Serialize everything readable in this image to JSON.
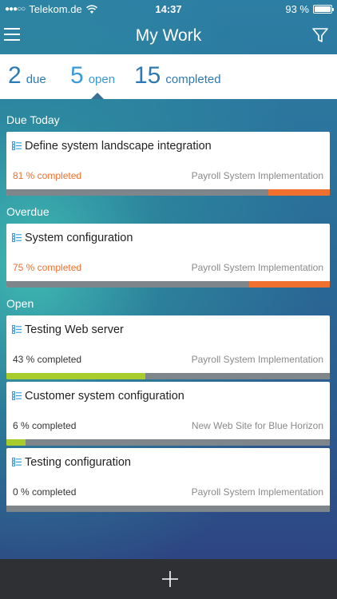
{
  "status_bar": {
    "signal": "●●●○○",
    "carrier": "Telekom.de",
    "time": "14:37",
    "battery": "93 %"
  },
  "nav": {
    "title": "My Work",
    "menu_icon": "hamburger-menu-icon",
    "filter_icon": "filter-funnel-icon"
  },
  "summary": {
    "items": [
      {
        "count": "2",
        "label": "due"
      },
      {
        "count": "5",
        "label": "open"
      },
      {
        "count": "15",
        "label": "completed"
      }
    ],
    "active": "open"
  },
  "sections": {
    "due_today": "Due Today",
    "overdue": "Overdue",
    "open": "Open"
  },
  "colors": {
    "accent": "#3a9ad9",
    "overdue": "#f07030",
    "progress": "#a8cc2c",
    "track": "#7e868b"
  },
  "tasks": [
    {
      "title": "Define system landscape integration",
      "percent_text": "81 % completed",
      "project": "Payroll System Implementation",
      "progress": 0.81,
      "status": "due"
    },
    {
      "title": "System configuration",
      "percent_text": "75 % completed",
      "project": "Payroll System Implementation",
      "progress": 0.75,
      "status": "overdue"
    },
    {
      "title": "Testing Web server",
      "percent_text": "43 % completed",
      "project": "Payroll System Implementation",
      "progress": 0.43,
      "status": "open"
    },
    {
      "title": "Customer system configuration",
      "percent_text": "6 % completed",
      "project": "New Web Site for Blue Horizon",
      "progress": 0.06,
      "status": "open"
    },
    {
      "title": "Testing configuration",
      "percent_text": "0 % completed",
      "project": "Payroll System Implementation",
      "progress": 0.0,
      "status": "open"
    }
  ],
  "bottom_bar": {
    "add_icon": "plus-icon"
  }
}
